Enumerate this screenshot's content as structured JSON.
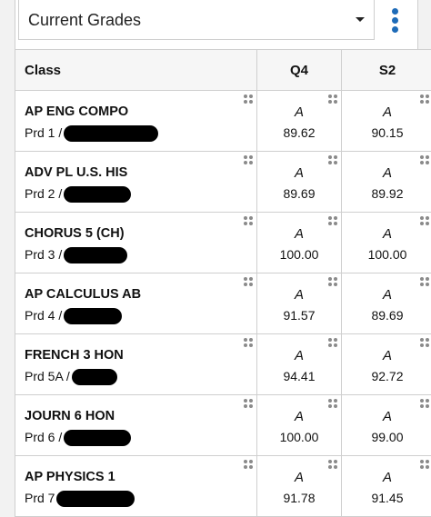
{
  "dropdown": {
    "selected": "Current Grades"
  },
  "menu_icon": "kebab-menu-icon",
  "colors": {
    "accent": "#1e6bb8",
    "border": "#cfcfcf",
    "header_bg": "#f6f6f6"
  },
  "table": {
    "headers": {
      "class": "Class",
      "q4": "Q4",
      "s2": "S2"
    },
    "rows": [
      {
        "name": "AP ENG COMPO",
        "period": "Prd 1 /",
        "q4_letter": "A",
        "q4_pct": "89.62",
        "s2_letter": "A",
        "s2_pct": "90.15"
      },
      {
        "name": "ADV PL U.S. HIS",
        "period": "Prd 2 /",
        "q4_letter": "A",
        "q4_pct": "89.69",
        "s2_letter": "A",
        "s2_pct": "89.92"
      },
      {
        "name": "CHORUS 5 (CH)",
        "period": "Prd 3 /",
        "q4_letter": "A",
        "q4_pct": "100.00",
        "s2_letter": "A",
        "s2_pct": "100.00"
      },
      {
        "name": "AP CALCULUS AB",
        "period": "Prd 4 /",
        "q4_letter": "A",
        "q4_pct": "91.57",
        "s2_letter": "A",
        "s2_pct": "89.69"
      },
      {
        "name": "FRENCH 3 HON",
        "period": "Prd 5A /",
        "q4_letter": "A",
        "q4_pct": "94.41",
        "s2_letter": "A",
        "s2_pct": "92.72"
      },
      {
        "name": "JOURN 6 HON",
        "period": "Prd 6 /",
        "q4_letter": "A",
        "q4_pct": "100.00",
        "s2_letter": "A",
        "s2_pct": "99.00"
      },
      {
        "name": "AP PHYSICS 1",
        "period": "Prd 7",
        "q4_letter": "A",
        "q4_pct": "91.78",
        "s2_letter": "A",
        "s2_pct": "91.45"
      }
    ]
  }
}
